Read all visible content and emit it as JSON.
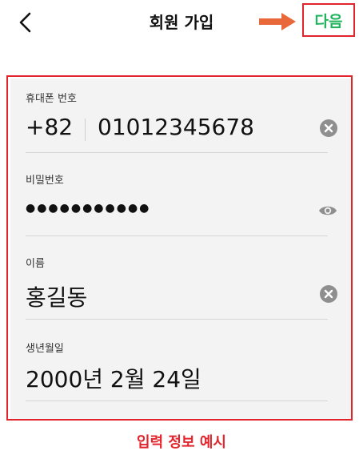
{
  "header": {
    "title": "회원 가입",
    "next_label": "다음"
  },
  "form": {
    "phone": {
      "label": "휴대폰 번호",
      "country_code": "+82",
      "number": "01012345678"
    },
    "password": {
      "label": "비밀번호",
      "masked_value": "●●●●●●●●●●●"
    },
    "name": {
      "label": "이름",
      "value": "홍길동"
    },
    "birthdate": {
      "label": "생년월일",
      "value": "2000년 2월 24일"
    }
  },
  "annotation": {
    "caption": "입력 정보 예시"
  },
  "colors": {
    "accent_green": "#22b35e",
    "highlight_red": "#e2252d",
    "arrow_orange": "#e8683a",
    "card_bg": "#f3f3f3",
    "icon_gray": "#8f8f8f"
  },
  "icons": {
    "back": "chevron-left-icon",
    "clear": "clear-circle-x-icon",
    "visibility": "eye-icon",
    "pointer": "arrow-right-icon"
  }
}
